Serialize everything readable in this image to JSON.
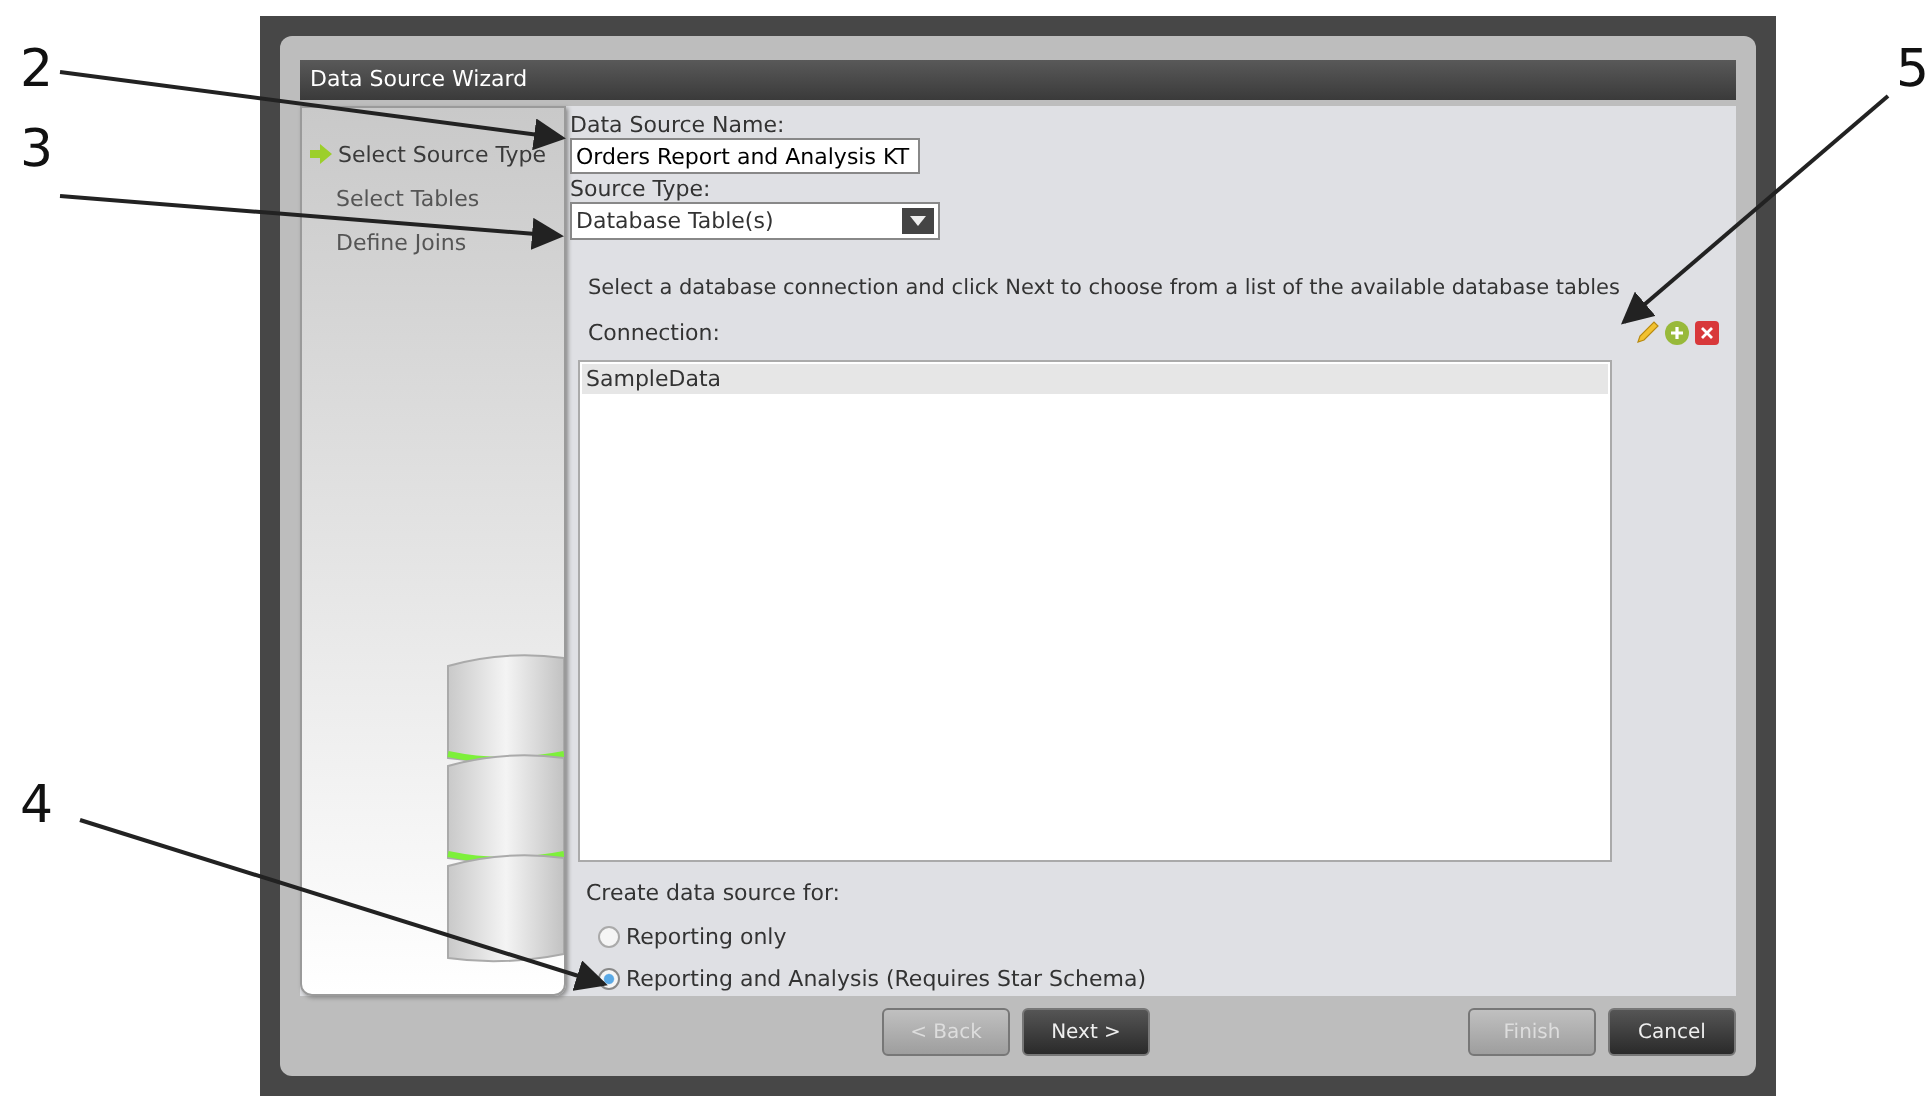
{
  "window": {
    "title": "Data Source Wizard"
  },
  "steps": [
    {
      "label": "Select Source Type",
      "selected": true
    },
    {
      "label": "Select Tables",
      "selected": false
    },
    {
      "label": "Define Joins",
      "selected": false
    }
  ],
  "name_field": {
    "label": "Data Source Name:",
    "value": "Orders Report and Analysis KT"
  },
  "type_field": {
    "label": "Source Type:",
    "value": "Database Table(s)"
  },
  "instructions": "Select a database connection and click Next to choose from a list of the available database tables",
  "connection": {
    "label": "Connection:",
    "items": [
      {
        "label": "SampleData",
        "selected": true
      }
    ]
  },
  "create_for": {
    "label": "Create data source for:",
    "options": [
      {
        "label": "Reporting only",
        "selected": false
      },
      {
        "label": "Reporting and Analysis (Requires Star Schema)",
        "selected": true
      }
    ]
  },
  "buttons": [
    {
      "label": "< Back",
      "disabled": true,
      "kind": "nav"
    },
    {
      "label": "Next >",
      "disabled": false,
      "kind": "nav"
    },
    {
      "label": "Finish",
      "disabled": true,
      "kind": "end"
    },
    {
      "label": "Cancel",
      "disabled": false,
      "kind": "end"
    }
  ],
  "callouts": [
    {
      "label": "2"
    },
    {
      "label": "3"
    },
    {
      "label": "4"
    },
    {
      "label": "5"
    }
  ]
}
